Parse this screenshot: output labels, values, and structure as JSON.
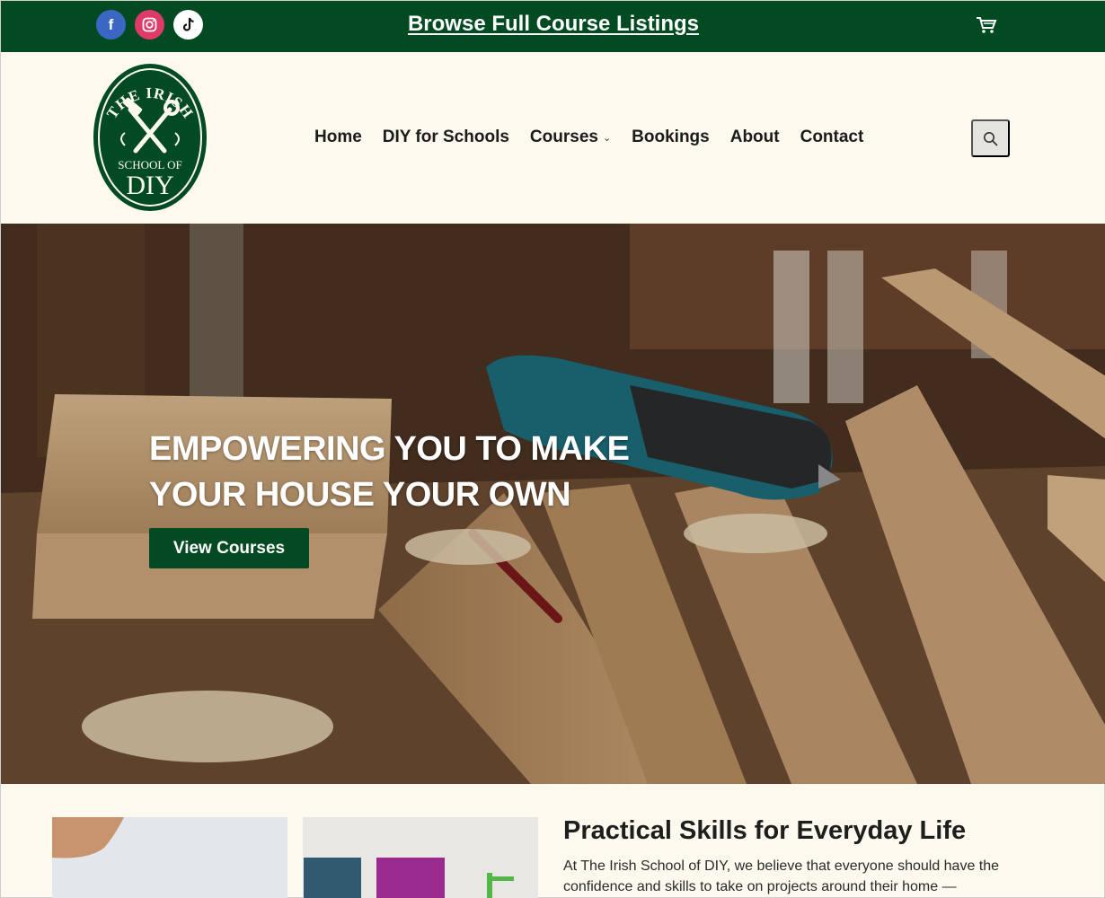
{
  "topbar": {
    "social": [
      {
        "name": "facebook-icon",
        "glyph": "f"
      },
      {
        "name": "instagram-icon",
        "glyph": "◎"
      },
      {
        "name": "tiktok-icon",
        "glyph": "♪"
      }
    ],
    "browse_link": "Browse Full Course Listings",
    "background": "#024b22"
  },
  "header": {
    "logo": {
      "line1": "THE IRISH",
      "line2": "SCHOOL OF",
      "line3": "DIY"
    },
    "nav": {
      "home": "Home",
      "schools": "DIY for Schools",
      "courses": "Courses",
      "courses_chevron": "⌄",
      "bookings": "Bookings",
      "about": "About",
      "contact": "Contact"
    }
  },
  "hero": {
    "title_line1": "EMPOWERING YOU TO MAKE",
    "title_line2": "YOUR HOUSE YOUR OWN",
    "button": "View Courses"
  },
  "intro": {
    "title": "Practical Skills for Everyday Life",
    "body": "At The Irish School of DIY, we believe that everyone should have the confidence and skills to take on projects around their home —"
  },
  "colors": {
    "brand_green": "#024b22",
    "cream": "#fdf9ee"
  }
}
